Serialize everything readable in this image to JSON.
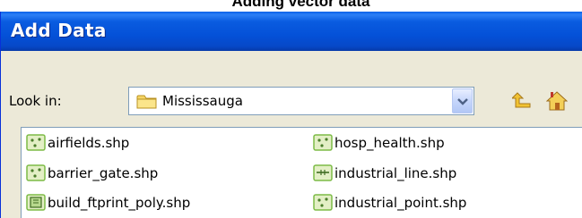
{
  "caption": "Adding vector data",
  "dialog": {
    "title": "Add Data",
    "look_in_label": "Look in:",
    "look_in_value": "Mississauga"
  },
  "toolbar": {
    "up_icon": "up-one-level-icon",
    "home_icon": "home-icon"
  },
  "files": [
    {
      "name": "airfields.shp",
      "icon": "point-shapefile-icon"
    },
    {
      "name": "barrier_gate.shp",
      "icon": "point-shapefile-icon"
    },
    {
      "name": "build_ftprint_poly.shp",
      "icon": "polygon-shapefile-icon"
    },
    {
      "name": "hosp_health.shp",
      "icon": "point-shapefile-icon"
    },
    {
      "name": "industrial_line.shp",
      "icon": "line-shapefile-icon"
    },
    {
      "name": "industrial_point.shp",
      "icon": "point-shapefile-icon"
    }
  ],
  "colors": {
    "titlebar": "#0451d8",
    "dialog_bg": "#ece9d8",
    "shp_icon_green": "#7dbb47"
  }
}
